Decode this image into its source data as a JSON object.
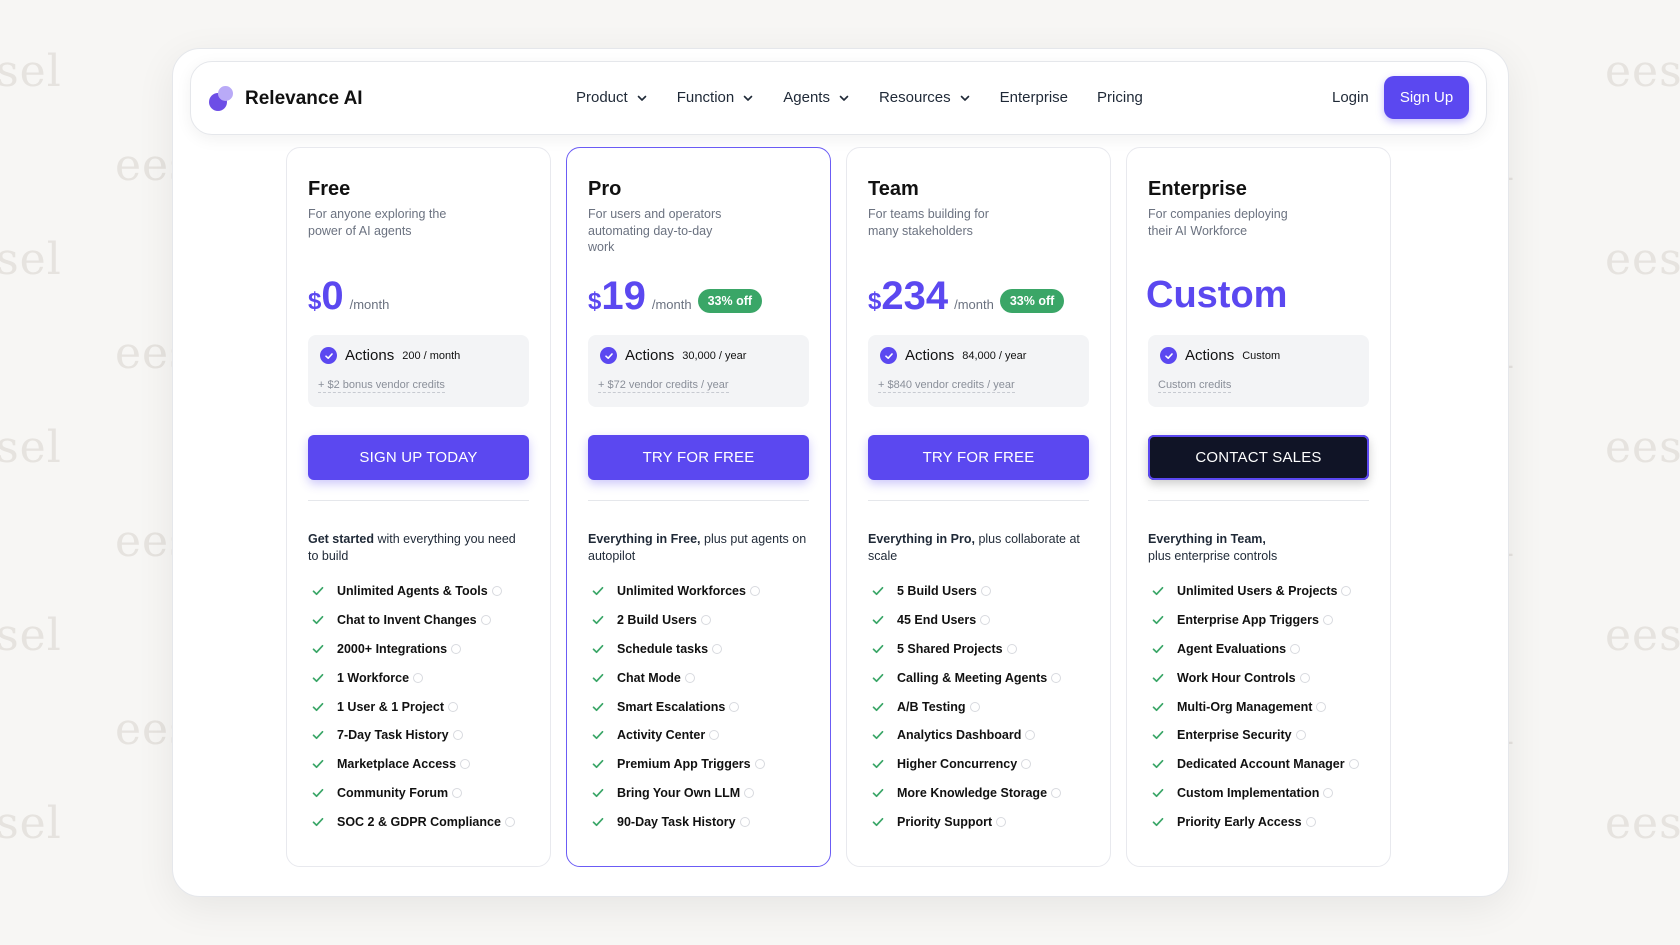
{
  "watermark": "eesel",
  "colors": {
    "accent": "#5b48f0",
    "success": "#3aa667",
    "dark": "#101426"
  },
  "nav": {
    "brand": "Relevance AI",
    "items": [
      {
        "label": "Product",
        "has_dropdown": true
      },
      {
        "label": "Function",
        "has_dropdown": true
      },
      {
        "label": "Agents",
        "has_dropdown": true
      },
      {
        "label": "Resources",
        "has_dropdown": true
      },
      {
        "label": "Enterprise",
        "has_dropdown": false
      },
      {
        "label": "Pricing",
        "has_dropdown": false
      }
    ],
    "login": "Login",
    "signup": "Sign Up"
  },
  "plans": [
    {
      "name": "Free",
      "desc": "For anyone exploring the power of AI agents",
      "currency": "$",
      "price": "0",
      "period": "/month",
      "discount": "",
      "actions_label": "Actions",
      "actions_qty": "200 / month",
      "credits": "+ $2 bonus vendor credits",
      "cta": "SIGN UP TODAY",
      "intro_bold": "Get started",
      "intro_rest": " with everything you need to build",
      "features": [
        "Unlimited Agents & Tools",
        "Chat to Invent Changes",
        "2000+ Integrations",
        "1 Workforce",
        "1 User & 1 Project",
        "7-Day Task History",
        "Marketplace Access",
        "Community Forum",
        "SOC 2 & GDPR Compliance"
      ]
    },
    {
      "name": "Pro",
      "desc": "For users and operators automating day-to-day work",
      "currency": "$",
      "price": "19",
      "period": "/month",
      "discount": "33% off",
      "actions_label": "Actions",
      "actions_qty": "30,000 / year",
      "credits": "+ $72 vendor credits / year",
      "cta": "TRY FOR FREE",
      "intro_bold": "Everything in Free,",
      "intro_rest": " plus put agents on autopilot",
      "features": [
        "Unlimited Workforces",
        "2 Build Users",
        "Schedule tasks",
        "Chat Mode",
        "Smart Escalations",
        "Activity Center",
        "Premium App Triggers",
        "Bring Your Own LLM",
        "90-Day Task History"
      ]
    },
    {
      "name": "Team",
      "desc": "For teams building for many stakeholders",
      "currency": "$",
      "price": "234",
      "period": "/month",
      "discount": "33% off",
      "actions_label": "Actions",
      "actions_qty": "84,000 / year",
      "credits": "+ $840 vendor credits / year",
      "cta": "TRY FOR FREE",
      "intro_bold": "Everything in Pro,",
      "intro_rest": " plus collaborate at scale",
      "features": [
        "5 Build Users",
        "45 End Users",
        "5 Shared Projects",
        "Calling & Meeting Agents",
        "A/B Testing",
        "Analytics Dashboard",
        "Higher Concurrency",
        "More Knowledge Storage",
        "Priority Support"
      ]
    },
    {
      "name": "Enterprise",
      "desc": "For companies deploying their AI Workforce",
      "custom_price": "Custom",
      "actions_label": "Actions",
      "actions_qty": "Custom",
      "credits": "Custom credits",
      "cta": "CONTACT SALES",
      "intro_bold": "Everything in Team,",
      "intro_rest": " plus enterprise controls",
      "features": [
        "Unlimited Users & Projects",
        "Enterprise App Triggers",
        "Agent Evaluations",
        "Work Hour Controls",
        "Multi-Org Management",
        "Enterprise Security",
        "Dedicated Account Manager",
        "Custom Implementation",
        "Priority Early Access"
      ]
    }
  ]
}
